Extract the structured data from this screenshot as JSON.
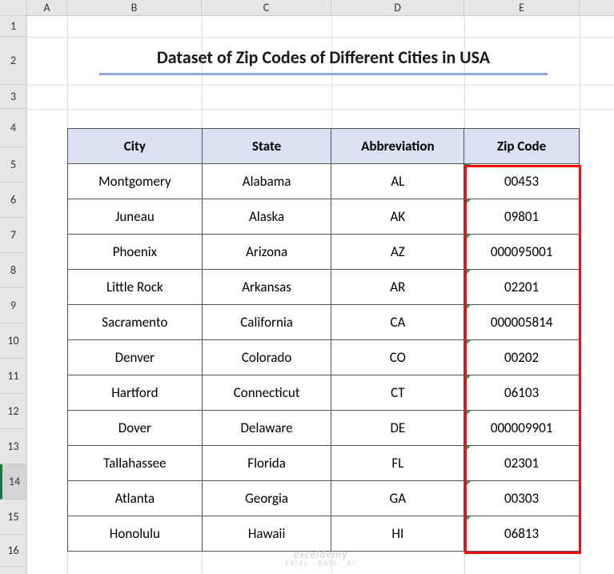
{
  "columns": [
    "A",
    "B",
    "C",
    "D",
    "E"
  ],
  "rows": [
    "1",
    "2",
    "3",
    "4",
    "5",
    "6",
    "7",
    "8",
    "9",
    "10",
    "11",
    "12",
    "13",
    "14",
    "15",
    "16"
  ],
  "selected_row": "14",
  "title": "Dataset of Zip Codes of Different Cities in USA",
  "headers": {
    "city": "City",
    "state": "State",
    "abbr": "Abbreviation",
    "zip": "Zip Code"
  },
  "data": [
    {
      "city": "Montgomery",
      "state": "Alabama",
      "abbr": "AL",
      "zip": "00453"
    },
    {
      "city": "Juneau",
      "state": "Alaska",
      "abbr": "AK",
      "zip": "09801"
    },
    {
      "city": "Phoenix",
      "state": "Arizona",
      "abbr": "AZ",
      "zip": "000095001"
    },
    {
      "city": "Little Rock",
      "state": "Arkansas",
      "abbr": "AR",
      "zip": "02201"
    },
    {
      "city": "Sacramento",
      "state": "California",
      "abbr": "CA",
      "zip": "000005814"
    },
    {
      "city": "Denver",
      "state": "Colorado",
      "abbr": "CO",
      "zip": "00202"
    },
    {
      "city": "Hartford",
      "state": "Connecticut",
      "abbr": "CT",
      "zip": "06103"
    },
    {
      "city": "Dover",
      "state": "Delaware",
      "abbr": "DE",
      "zip": "000009901"
    },
    {
      "city": "Tallahassee",
      "state": "Florida",
      "abbr": "FL",
      "zip": "02301"
    },
    {
      "city": "Atlanta",
      "state": "Georgia",
      "abbr": "GA",
      "zip": "00303"
    },
    {
      "city": "Honolulu",
      "state": "Hawaii",
      "abbr": "HI",
      "zip": "06813"
    }
  ],
  "watermark": {
    "main": "exceldemy",
    "sub": "EXCEL · DATA · BI"
  },
  "chart_data": {
    "type": "table",
    "title": "Dataset of Zip Codes of Different Cities in USA",
    "columns": [
      "City",
      "State",
      "Abbreviation",
      "Zip Code"
    ],
    "rows": [
      [
        "Montgomery",
        "Alabama",
        "AL",
        "00453"
      ],
      [
        "Juneau",
        "Alaska",
        "AK",
        "09801"
      ],
      [
        "Phoenix",
        "Arizona",
        "AZ",
        "000095001"
      ],
      [
        "Little Rock",
        "Arkansas",
        "AR",
        "02201"
      ],
      [
        "Sacramento",
        "California",
        "CA",
        "000005814"
      ],
      [
        "Denver",
        "Colorado",
        "CO",
        "00202"
      ],
      [
        "Hartford",
        "Connecticut",
        "CT",
        "06103"
      ],
      [
        "Dover",
        "Delaware",
        "DE",
        "000009901"
      ],
      [
        "Tallahassee",
        "Florida",
        "FL",
        "02301"
      ],
      [
        "Atlanta",
        "Georgia",
        "GA",
        "00303"
      ],
      [
        "Honolulu",
        "Hawaii",
        "HI",
        "06813"
      ]
    ]
  }
}
